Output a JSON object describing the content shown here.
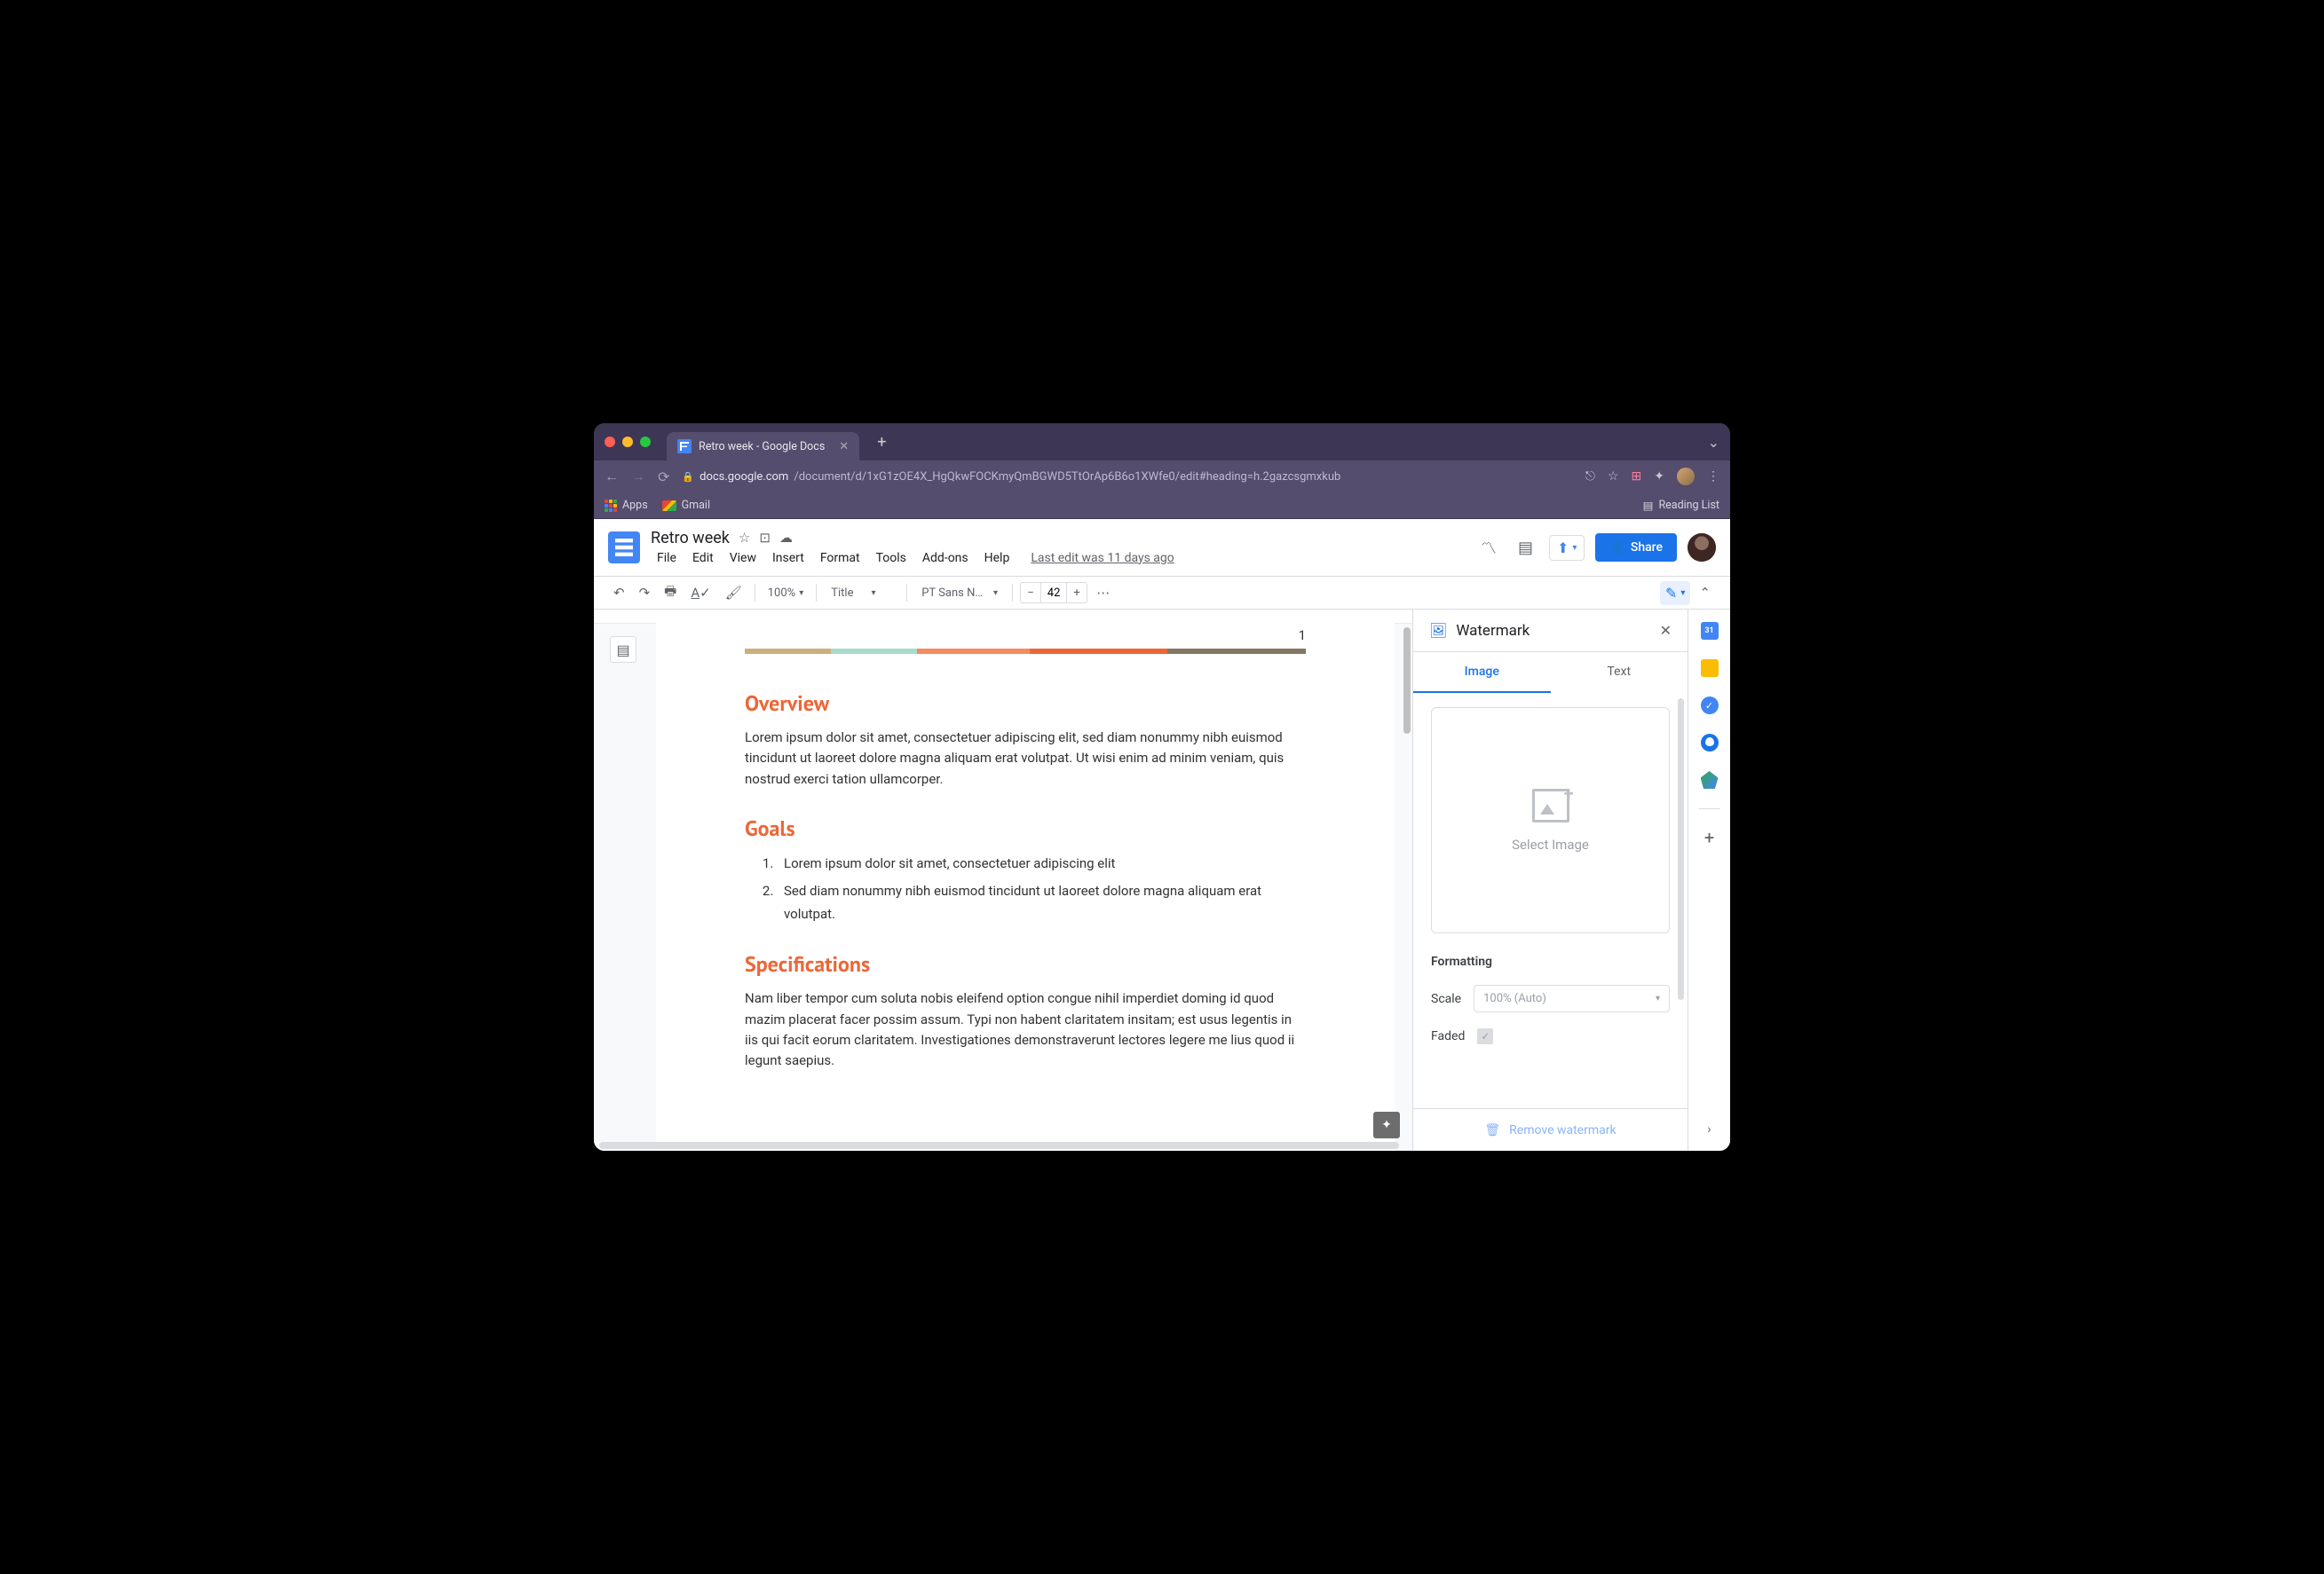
{
  "browser": {
    "tab_title": "Retro week - Google Docs",
    "url_host": "docs.google.com",
    "url_path": "/document/d/1xG1zOE4X_HgQkwFOCKmyQmBGWD5TtOrAp6B6o1XWfe0/edit#heading=h.2gazcsgmxkub",
    "bookmarks": {
      "apps": "Apps",
      "gmail": "Gmail",
      "reading_list": "Reading List"
    }
  },
  "doc": {
    "title": "Retro week",
    "menus": [
      "File",
      "Edit",
      "View",
      "Insert",
      "Format",
      "Tools",
      "Add-ons",
      "Help"
    ],
    "last_edit": "Last edit was 11 days ago",
    "share_label": "Share"
  },
  "toolbar": {
    "zoom": "100%",
    "style": "Title",
    "font": "PT Sans N…",
    "font_size": "42"
  },
  "page": {
    "number": "1",
    "sections": {
      "overview": {
        "title": "Overview",
        "body": "Lorem ipsum dolor sit amet, consectetuer adipiscing elit, sed diam nonummy nibh euismod tincidunt ut laoreet dolore magna aliquam erat volutpat. Ut wisi enim ad minim veniam, quis nostrud exerci tation ullamcorper."
      },
      "goals": {
        "title": "Goals",
        "items": [
          "Lorem ipsum dolor sit amet, consectetuer adipiscing elit",
          "Sed diam nonummy nibh euismod tincidunt ut laoreet dolore magna aliquam erat volutpat."
        ]
      },
      "specs": {
        "title": "Specifications",
        "body": "Nam liber tempor cum soluta nobis eleifend option congue nihil imperdiet doming id quod mazim placerat facer possim assum. Typi non habent claritatem insitam; est usus legentis in iis qui facit eorum claritatem. Investigationes demonstraverunt lectores legere me lius quod ii legunt saepius."
      }
    }
  },
  "sidepanel": {
    "title": "Watermark",
    "tabs": {
      "image": "Image",
      "text": "Text"
    },
    "select_image": "Select Image",
    "formatting_label": "Formatting",
    "scale_label": "Scale",
    "scale_value": "100% (Auto)",
    "faded_label": "Faded",
    "remove_label": "Remove watermark"
  },
  "rail": {
    "cal_day": "31"
  }
}
